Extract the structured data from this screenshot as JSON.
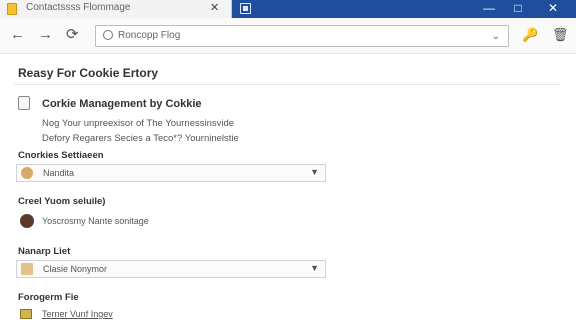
{
  "window": {
    "tab_title": "Contactssss Flommage",
    "close_glyph": "✕",
    "minimize_glyph": "—",
    "maximize_glyph": "□",
    "window_close_glyph": "✕"
  },
  "navbar": {
    "back_glyph": "←",
    "forward_glyph": "→",
    "refresh_glyph": "⟳",
    "address_text": "Roncopp Flog",
    "chevron_glyph": "⌄",
    "tools_glyph": "🔑",
    "trash_glyph": "🗑"
  },
  "page": {
    "title": "Reasy For Cookie Ertory",
    "section_title": "Corkie Management by Cokkie",
    "section_line1": "Nog Your unpreexisor of The Yournessinsvide",
    "section_line2": "Defory Regarers Secies a Teco*? Yourninelstie"
  },
  "groups": [
    {
      "label": "Cnorkies Settiaeen",
      "value": "Nandita",
      "icon_color": "#d8a867"
    },
    {
      "label": "Creel Yuom seluile)",
      "row_text": "Yoscrosmy Nante sonitage",
      "icon_color": "#5b3a2a"
    },
    {
      "label": "Nanarp Liet",
      "value": "Clasie Nonymor",
      "icon_color": "#e2c48a"
    },
    {
      "label": "Forogerm Fie",
      "link_text": "Terner Vunf Ingev"
    }
  ]
}
